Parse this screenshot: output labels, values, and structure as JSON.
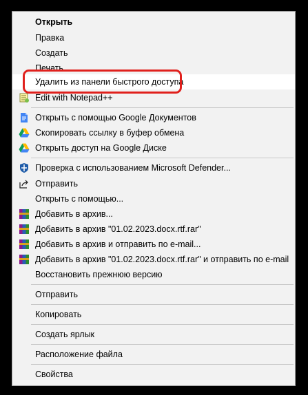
{
  "menu": {
    "items": [
      {
        "label": "Открыть"
      },
      {
        "label": "Правка"
      },
      {
        "label": "Создать"
      },
      {
        "label": "Печать"
      },
      {
        "label": "Удалить из панели быстрого доступа"
      },
      {
        "label": "Edit with Notepad++"
      },
      {
        "label": "Открыть с помощью Google Документов"
      },
      {
        "label": "Скопировать ссылку в буфер обмена"
      },
      {
        "label": "Открыть доступ на Google Диске"
      },
      {
        "label": "Проверка с использованием Microsoft Defender..."
      },
      {
        "label": "Отправить"
      },
      {
        "label": "Открыть с помощью..."
      },
      {
        "label": "Добавить в архив..."
      },
      {
        "label": "Добавить в архив \"01.02.2023.docx.rtf.rar\""
      },
      {
        "label": "Добавить в архив и отправить по e-mail..."
      },
      {
        "label": "Добавить в архив \"01.02.2023.docx.rtf.rar\" и отправить по e-mail"
      },
      {
        "label": "Восстановить прежнюю версию"
      },
      {
        "label": "Отправить"
      },
      {
        "label": "Копировать"
      },
      {
        "label": "Создать ярлык"
      },
      {
        "label": "Расположение файла"
      },
      {
        "label": "Свойства"
      }
    ]
  },
  "colors": {
    "highlight_border": "#e0201c",
    "menu_bg": "#f2f2f2",
    "background": "#000000"
  }
}
